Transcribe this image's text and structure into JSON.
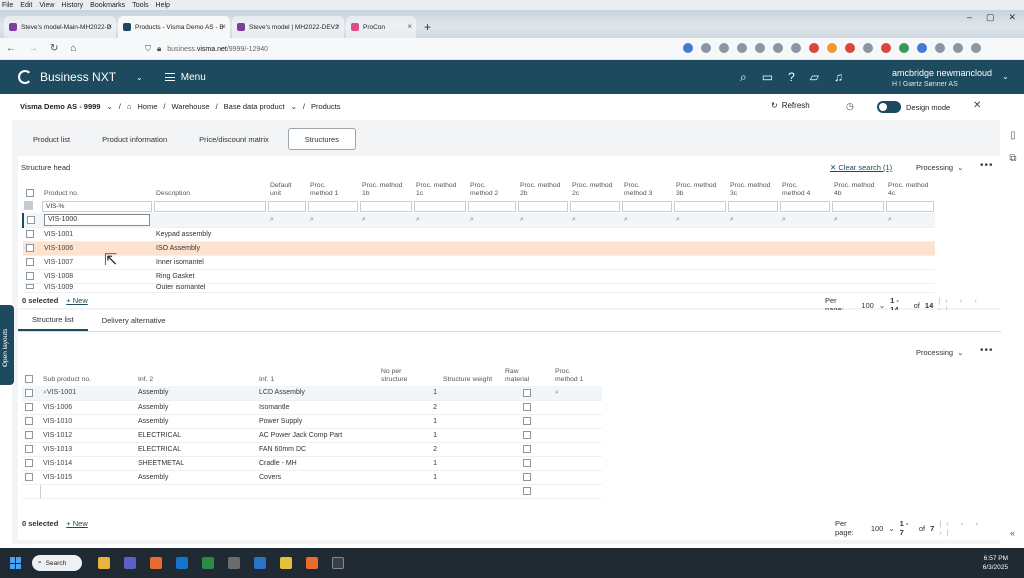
{
  "browser": {
    "menu": [
      "File",
      "Edit",
      "View",
      "History",
      "Bookmarks",
      "Tools",
      "Help"
    ],
    "tabs": [
      {
        "title": "Steve's model-Main-MH2022-D",
        "active": false
      },
      {
        "title": "Products - Visma Demo AS - B",
        "active": true
      },
      {
        "title": "Steve's model | MH2022-DEV2",
        "active": false
      },
      {
        "title": "ProCon",
        "active": false
      }
    ],
    "url_prefix": "business.",
    "url_domain": "visma.net",
    "url_path": "/9999/-12940"
  },
  "app": {
    "brand": "Business NXT",
    "menu_label": "Menu",
    "user_name": "amcbridge newmancloud",
    "company": "H I Giørtz Sønner AS"
  },
  "breadcrumb": {
    "company": "Visma Demo AS - 9999",
    "items": [
      "Home",
      "Warehouse",
      "Base data product",
      "Products"
    ],
    "refresh": "Refresh",
    "design_mode": "Design mode",
    "design_mode_on": true
  },
  "page_tabs": [
    {
      "label": "Product list",
      "active": false
    },
    {
      "label": "Product information",
      "active": false
    },
    {
      "label": "Price/discount matrix",
      "active": false
    },
    {
      "label": "Structures",
      "active": true
    }
  ],
  "structure_head": {
    "title": "Structure head",
    "clear_search": "Clear search (1)",
    "processing": "Processing",
    "columns": [
      {
        "line1": "Product no.",
        "line2": ""
      },
      {
        "line1": "Description",
        "line2": ""
      },
      {
        "line1": "Default",
        "line2": "unit"
      },
      {
        "line1": "Proc.",
        "line2": "method 1"
      },
      {
        "line1": "Proc. method",
        "line2": "1b"
      },
      {
        "line1": "Proc. method",
        "line2": "1c"
      },
      {
        "line1": "Proc.",
        "line2": "method 2"
      },
      {
        "line1": "Proc. method",
        "line2": "2b"
      },
      {
        "line1": "Proc. method",
        "line2": "2c"
      },
      {
        "line1": "Proc.",
        "line2": "method 3"
      },
      {
        "line1": "Proc. method",
        "line2": "3b"
      },
      {
        "line1": "Proc. method",
        "line2": "3c"
      },
      {
        "line1": "Proc.",
        "line2": "method 4"
      },
      {
        "line1": "Proc. method",
        "line2": "4b"
      },
      {
        "line1": "Proc. method",
        "line2": "4c"
      }
    ],
    "filter_value": "VIS-%",
    "rows": [
      {
        "no": "VIS-1000",
        "desc": ""
      },
      {
        "no": "VIS-1001",
        "desc": "Keypad assembly"
      },
      {
        "no": "VIS-1006",
        "desc": "ISO Assembly"
      },
      {
        "no": "VIS-1007",
        "desc": "Inner isomantel"
      },
      {
        "no": "VIS-1008",
        "desc": "Ring Gasket"
      },
      {
        "no": "VIS-1009",
        "desc": "Outer isomantel"
      }
    ],
    "selected": "0 selected",
    "new": "New",
    "per_page_label": "Per page:",
    "per_page": "100",
    "range": "1 - 14",
    "of": "of",
    "total": "14"
  },
  "structure_list": {
    "tabs": [
      {
        "label": "Structure list",
        "active": true
      },
      {
        "label": "Delivery alternative",
        "active": false
      }
    ],
    "processing": "Processing",
    "columns": [
      {
        "line1": "Sub product no.",
        "line2": ""
      },
      {
        "line1": "Inf. 2",
        "line2": ""
      },
      {
        "line1": "Inf. 1",
        "line2": ""
      },
      {
        "line1": "No per",
        "line2": "structure"
      },
      {
        "line1": "Structure weight",
        "line2": ""
      },
      {
        "line1": "Raw",
        "line2": "material"
      },
      {
        "line1": "Proc.",
        "line2": "method 1"
      }
    ],
    "rows": [
      {
        "no": "VIS-1001",
        "inf2": "Assembly",
        "inf1": "LCD Assembly",
        "qty": "1"
      },
      {
        "no": "VIS-1006",
        "inf2": "Assembly",
        "inf1": "Isomantle",
        "qty": "2"
      },
      {
        "no": "VIS-1010",
        "inf2": "Assembly",
        "inf1": "Power Supply",
        "qty": "1"
      },
      {
        "no": "VIS-1012",
        "inf2": "ELECTRICAL",
        "inf1": "AC Power Jack Comp Part",
        "qty": "1"
      },
      {
        "no": "VIS-1013",
        "inf2": "ELECTRICAL",
        "inf1": "FAN 60mm DC",
        "qty": "2"
      },
      {
        "no": "VIS-1014",
        "inf2": "SHEETMETAL",
        "inf1": "Cradle - MH",
        "qty": "1"
      },
      {
        "no": "VIS-1015",
        "inf2": "Assembly",
        "inf1": "Covers",
        "qty": "1"
      }
    ],
    "selected": "0 selected",
    "new": "New",
    "per_page_label": "Per page:",
    "per_page": "100",
    "range": "1 - 7",
    "of": "of",
    "total": "7"
  },
  "sidebar": {
    "open_layouts": "Open layouts"
  },
  "taskbar": {
    "search": "Search",
    "time": "6:57 PM",
    "date": "6/3/2025"
  },
  "colors": {
    "header": "#1d4a5e",
    "highlight_row": "#fde3cf",
    "accent": "#1d4a5e"
  }
}
